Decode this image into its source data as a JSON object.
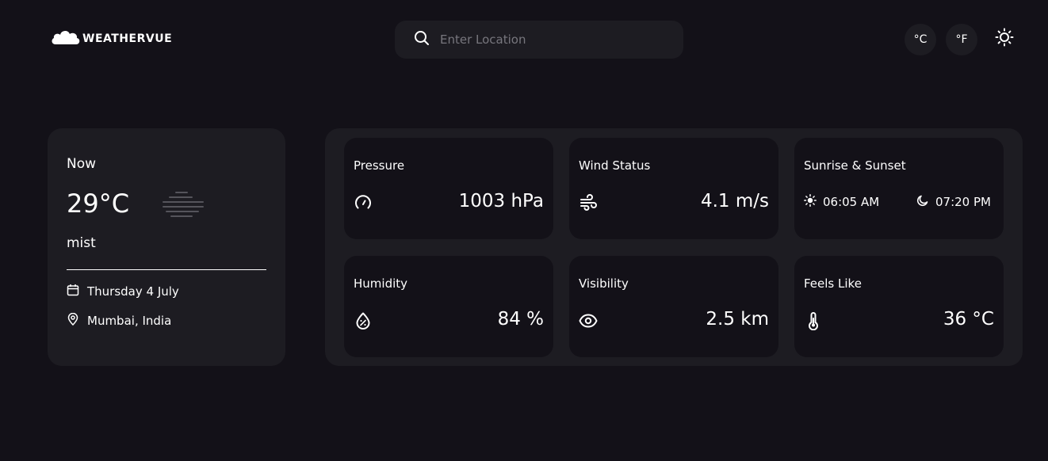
{
  "header": {
    "logo_text": "WEATHERVUE",
    "search_placeholder": "Enter Location",
    "celsius_label": "°C",
    "fahrenheit_label": "°F"
  },
  "now": {
    "label": "Now",
    "temperature": "29°C",
    "condition": "mist",
    "date": "Thursday 4 July",
    "location": "Mumbai, India"
  },
  "highlights": {
    "pressure": {
      "title": "Pressure",
      "value": "1003 hPa"
    },
    "wind": {
      "title": "Wind Status",
      "value": "4.1 m/s"
    },
    "sun": {
      "title": "Sunrise & Sunset",
      "sunrise": "06:05 AM",
      "sunset": "07:20 PM"
    },
    "humidity": {
      "title": "Humidity",
      "value": "84 %"
    },
    "visibility": {
      "title": "Visibility",
      "value": "2.5 km"
    },
    "feels_like": {
      "title": "Feels Like",
      "value": "36 °C"
    }
  },
  "icons": {
    "logo": "cloud-icon",
    "search": "search-icon",
    "theme": "sun-icon",
    "condition": "mist-icon",
    "date": "calendar-icon",
    "location": "map-pin-icon",
    "pressure": "gauge-icon",
    "wind": "wind-icon",
    "sunrise": "sun-icon",
    "sunset": "moon-icon",
    "humidity": "droplet-icon",
    "visibility": "eye-icon",
    "feels_like": "thermometer-icon"
  },
  "colors": {
    "background": "#131118",
    "card": "#1d1c22",
    "text": "#ffffff",
    "placeholder": "#77767d"
  }
}
